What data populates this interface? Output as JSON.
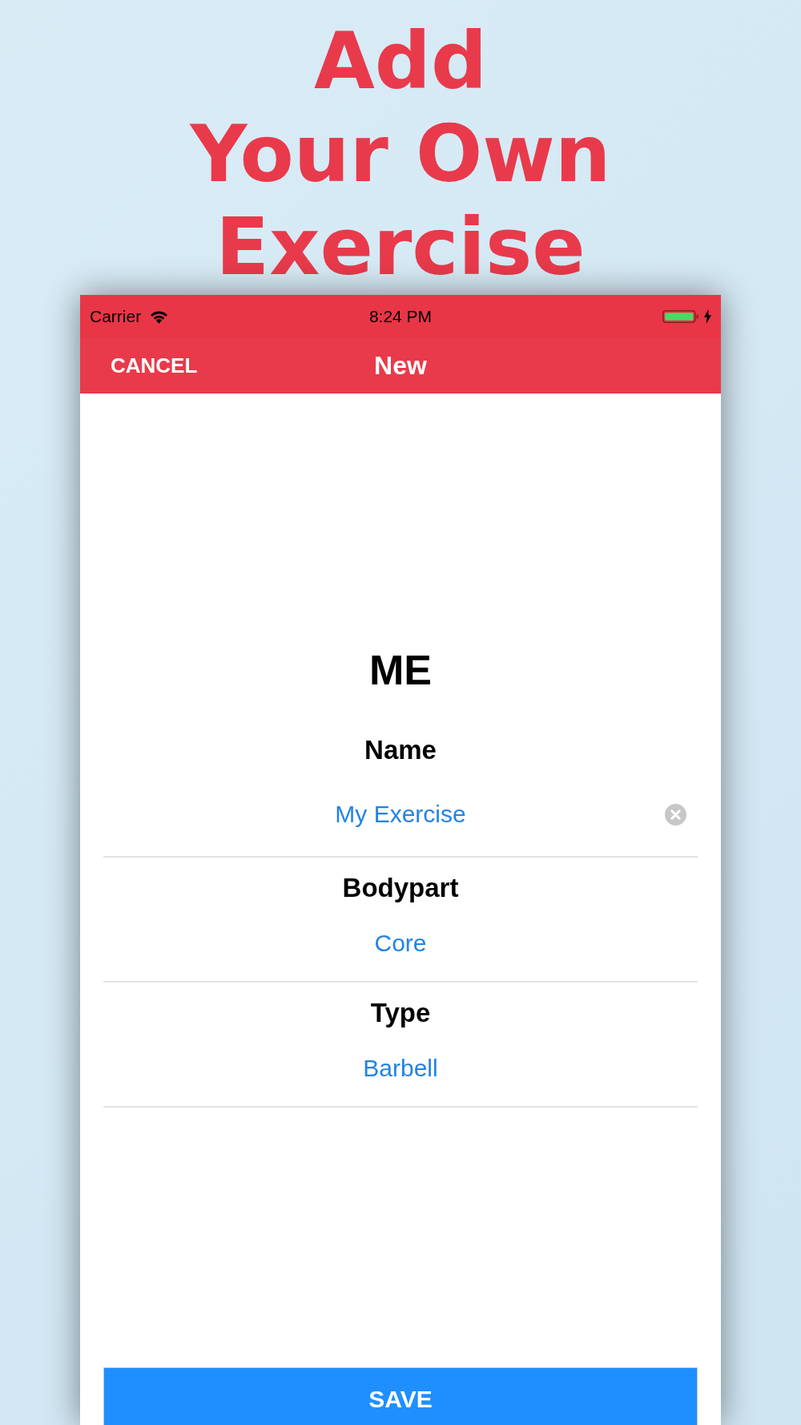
{
  "headline": [
    "Add",
    "Your Own",
    "Exercise"
  ],
  "status_bar": {
    "carrier": "Carrier",
    "time": "8:24 PM"
  },
  "nav_bar": {
    "left_button": "CANCEL",
    "title": "New"
  },
  "form": {
    "heading": "ME",
    "fields": [
      {
        "kind": "text",
        "label": "Name",
        "value": "My Exercise"
      },
      {
        "kind": "picker",
        "label": "Bodypart",
        "value": "Core"
      },
      {
        "kind": "picker",
        "label": "Type",
        "value": "Barbell"
      }
    ],
    "save_button": "SAVE"
  }
}
